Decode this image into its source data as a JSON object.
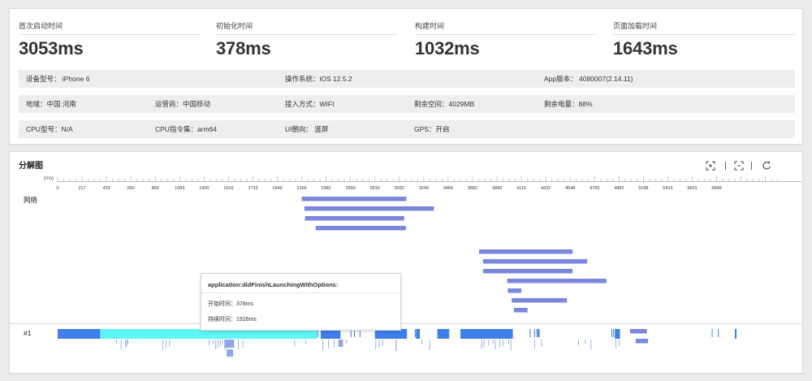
{
  "metrics": [
    {
      "label": "首次启动时间",
      "value": "3053ms"
    },
    {
      "label": "初始化时间",
      "value": "378ms"
    },
    {
      "label": "构建时间",
      "value": "1032ms"
    },
    {
      "label": "页面加载时间",
      "value": "1643ms"
    }
  ],
  "device_info": {
    "model": "设备型号： iPhone 6",
    "os": "操作系统：iOS 12.5.2",
    "app_version": "App版本： 4080007(2.14.11)",
    "region": "地域：中国 河南",
    "carrier": "运营商：中国移动",
    "network": "接入方式：WIFI",
    "storage": "剩余空间：4029MB",
    "battery": "剩余电量：88%",
    "cpu_model": "CPU型号：N/A",
    "cpu_arch": "CPU指令集：arm64",
    "ui_orientation": "UI朝向： 竖屏",
    "gps": "GPS：开启"
  },
  "breakdown": {
    "title": "分解图",
    "unit": "(ms)",
    "ticks": [
      "0",
      "217",
      "433",
      "650",
      "866",
      "1083",
      "1300",
      "1516",
      "1733",
      "1949",
      "2166",
      "2382",
      "2599",
      "2816",
      "3032",
      "3249",
      "3465",
      "3682",
      "3899",
      "4115",
      "4332",
      "4548",
      "4765",
      "4982",
      "5198",
      "5415",
      "5631",
      "5848"
    ],
    "tool_icons": [
      "expand-icon",
      "collapse-icon",
      "refresh-icon"
    ],
    "lane_network_label": "网络",
    "lane_thread_label": "#1",
    "colors": {
      "network": "#7b87dd",
      "thread": "#3f7fea",
      "highlight": "#5ef5f5",
      "ticks": "#8fa9e6"
    },
    "network_bars": [
      {
        "start": 2166,
        "end": 3095
      },
      {
        "start": 2190,
        "end": 3340
      },
      {
        "start": 2195,
        "end": 3075
      },
      {
        "start": 2290,
        "end": 3090
      },
      {
        "start": 3740,
        "end": 4570
      },
      {
        "start": 3775,
        "end": 4700
      },
      {
        "start": 3775,
        "end": 4570
      },
      {
        "start": 3990,
        "end": 4870
      },
      {
        "start": 3995,
        "end": 4115
      },
      {
        "start": 4030,
        "end": 4520
      },
      {
        "start": 4050,
        "end": 4170
      },
      {
        "start": 5080,
        "end": 5230
      },
      {
        "start": 5130,
        "end": 5240
      }
    ],
    "thread_blocks": [
      {
        "start": 0,
        "end": 378,
        "highlight": false
      },
      {
        "start": 378,
        "end": 2304,
        "highlight": true
      },
      {
        "start": 2335,
        "end": 2510,
        "highlight": false
      },
      {
        "start": 2816,
        "end": 3100,
        "highlight": false
      },
      {
        "start": 3180,
        "end": 3215,
        "highlight": false
      },
      {
        "start": 3370,
        "end": 3475,
        "highlight": false
      },
      {
        "start": 3575,
        "end": 4040,
        "highlight": false
      },
      {
        "start": 4945,
        "end": 4990,
        "highlight": false
      },
      {
        "start": 6010,
        "end": 6025,
        "highlight": false
      }
    ],
    "tooltip": {
      "title": "application:didFinishLaunchingWithOptions:",
      "start": "开始时间：378ms",
      "duration": "持续时间：1926ms"
    }
  }
}
